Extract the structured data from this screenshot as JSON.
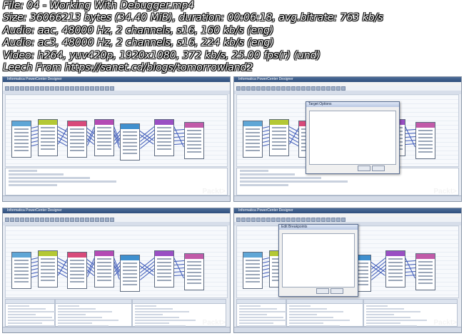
{
  "info": {
    "file": "File: 04 - Working With Debugger.mp4",
    "size": "Size: 36066213 bytes (34.40 MiB), duration: 00:06:18, avg.bitrate: 763 kb/s",
    "audio1": "Audio: aac, 48000 Hz, 2 channels, s16, 160 kb/s (eng)",
    "audio2": "Audio: ac3, 48000 Hz, 2 channels, s16, 224 kb/s (eng)",
    "video": "Video: h264, yuv420p, 1920x1080, 372 kb/s, 25.00 fps(r) (und)",
    "leech": "Leech From https://sanet.cd/blogs/tomorrowland2"
  },
  "thumbs": [
    {
      "title": "Informatica PowerCenter Designer",
      "watermark": "Packt>"
    },
    {
      "title": "Informatica PowerCenter Designer",
      "watermark": "Packt>",
      "dialog": "Target Options"
    },
    {
      "title": "Informatica PowerCenter Designer",
      "watermark": "Packt>"
    },
    {
      "title": "Informatica PowerCenter Designer",
      "watermark": "Packt>",
      "dialog": "Edit Breakpoints"
    }
  ],
  "colors": {
    "node_headers": [
      "#5fa6d6",
      "#b4c834",
      "#d84a7a",
      "#b44bb4",
      "#3f8fce",
      "#9a4fc3",
      "#c15aa8"
    ],
    "link": "#3b58b8",
    "window_title": "#2f4f7d"
  }
}
